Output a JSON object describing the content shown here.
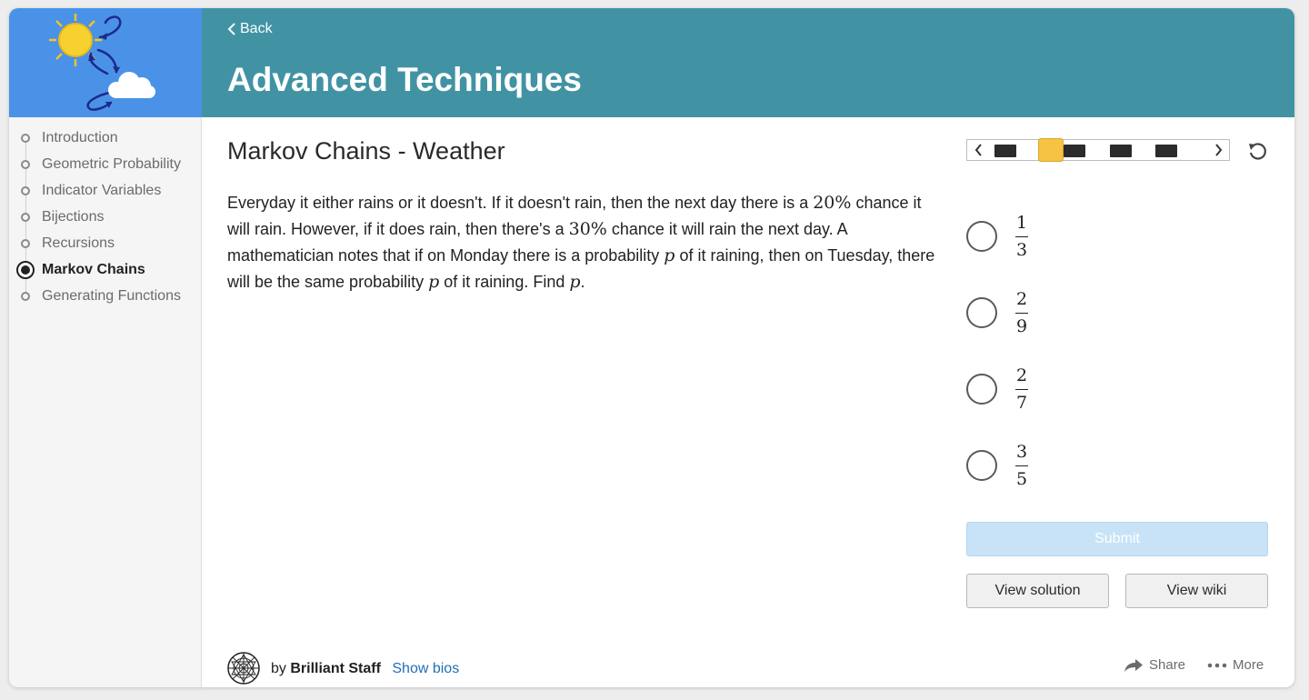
{
  "header": {
    "back_label": "Back",
    "title": "Advanced Techniques"
  },
  "sidebar": {
    "items": [
      {
        "label": "Introduction",
        "active": false
      },
      {
        "label": "Geometric Probability",
        "active": false
      },
      {
        "label": "Indicator Variables",
        "active": false
      },
      {
        "label": "Bijections",
        "active": false
      },
      {
        "label": "Recursions",
        "active": false
      },
      {
        "label": "Markov Chains",
        "active": true
      },
      {
        "label": "Generating Functions",
        "active": false
      }
    ]
  },
  "problem": {
    "title": "Markov Chains - Weather",
    "text": {
      "p1": "Everyday it either rains or it doesn't. If it doesn't rain, then the next day there is a ",
      "m1": "20%",
      "p2": " chance it will rain. However, if it does rain, then there's a ",
      "m2": "30%",
      "p3": " chance it will rain the next day. A mathematician notes that if on Monday there is a probability ",
      "m3": "p",
      "p4": " of it raining, then on Tuesday, there will be the same probability ",
      "m4": "p",
      "p5": " of it raining. Find ",
      "m5": "p",
      "p6": "."
    }
  },
  "progress": {
    "total_segments": 5,
    "current_segment": 2
  },
  "choices": [
    {
      "numerator": "1",
      "denominator": "3"
    },
    {
      "numerator": "2",
      "denominator": "9"
    },
    {
      "numerator": "2",
      "denominator": "7"
    },
    {
      "numerator": "3",
      "denominator": "5"
    }
  ],
  "actions": {
    "submit_label": "Submit",
    "view_solution_label": "View solution",
    "view_wiki_label": "View wiki"
  },
  "footer": {
    "by_label": "by",
    "author": "Brilliant Staff",
    "show_bios_label": "Show bios",
    "share_label": "Share",
    "more_label": "More"
  },
  "colors": {
    "header_bg": "#4193a4",
    "logo_bg": "#4a92e8",
    "progress_current": "#f6c442",
    "submit_disabled": "#c8e3f7",
    "link": "#1f6fb5"
  }
}
